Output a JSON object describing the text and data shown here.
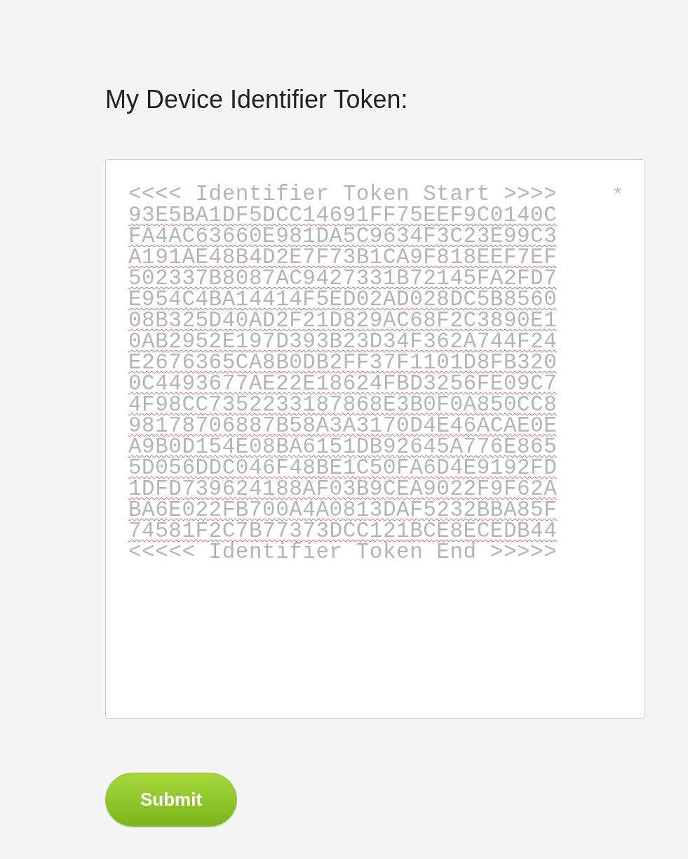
{
  "heading": "My Device Identifier Token:",
  "token_field": {
    "required_marker": "*",
    "lines": [
      {
        "text": "<<<< Identifier Token Start >>>>",
        "misspelled": false
      },
      {
        "text": "93E5BA1DF5DCC14691FF75EEF9C0140C",
        "misspelled": true
      },
      {
        "text": "FA4AC63660E981DA5C9634F3C23E99C3",
        "misspelled": true
      },
      {
        "text": "A191AE48B4D2E7F73B1CA9F818EEF7EF",
        "misspelled": true
      },
      {
        "text": "502337B8087AC9427331B72145FA2FD7",
        "misspelled": true
      },
      {
        "text": "E954C4BA14414F5ED02AD028DC5B8560",
        "misspelled": true
      },
      {
        "text": "08B325D40AD2F21D829AC68F2C3890E1",
        "misspelled": true
      },
      {
        "text": "0AB2952E197D393B23D34F362A744F24",
        "misspelled": true
      },
      {
        "text": "E2676365CA8B0DB2FF37F1101D8FB320",
        "misspelled": true
      },
      {
        "text": "0C4493677AE22E18624FBD3256FE09C7",
        "misspelled": true
      },
      {
        "text": "4F98CC7352233187868E3B0F0A850CC8",
        "misspelled": true
      },
      {
        "text": "98178706887B58A3A3170D4E46ACAE0E",
        "misspelled": true
      },
      {
        "text": "A9B0D154E08BA6151DB92645A776E865",
        "misspelled": true
      },
      {
        "text": "5D056DDC046F48BE1C50FA6D4E9192FD",
        "misspelled": true
      },
      {
        "text": "1DFD739624188AF03B9CEA9022F9F62A",
        "misspelled": true
      },
      {
        "text": "BA6E022FB700A4A0813DAF5232BBA85F",
        "misspelled": true
      },
      {
        "text": "74581F2C7B77373DCC121BCE8ECEDB44",
        "misspelled": true
      },
      {
        "text": "<<<<< Identifier Token End >>>>>",
        "misspelled": false
      }
    ]
  },
  "submit_button": "Submit"
}
